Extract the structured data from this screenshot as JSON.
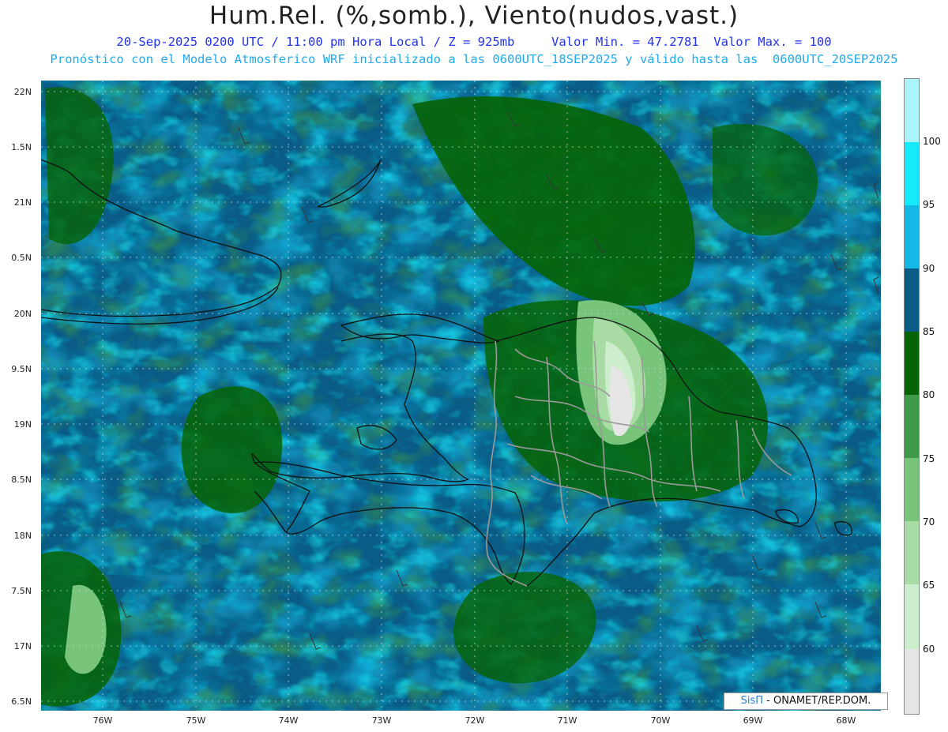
{
  "header": {
    "title": "Hum.Rel. (%,somb.), Viento(nudos,vast.)",
    "line1": "20-Sep-2025 0200 UTC / 11:00 pm Hora Local / Z = 925mb     Valor Min. = 47.2781  Valor Max. = 100",
    "line2": "Pronóstico con el Modelo Atmosferico WRF inicializado a las 0600UTC_18SEP2025 y válido hasta las  0600UTC_20SEP2025"
  },
  "map": {
    "latitude_labels": [
      "22N",
      "1.5N",
      "21N",
      "0.5N",
      "20N",
      "9.5N",
      "19N",
      "8.5N",
      "18N",
      "7.5N",
      "17N",
      "6.5N"
    ],
    "longitude_labels": [
      "76W",
      "75W",
      "74W",
      "73W",
      "72W",
      "71W",
      "70W",
      "69W",
      "68W"
    ],
    "colors": {
      "band_lt60": "#e6e6e6",
      "band_60_65": "#cdeecd",
      "band_65_70": "#a8dca4",
      "band_70_75": "#78c47a",
      "band_75_80": "#3e9a48",
      "band_80_85": "#066405",
      "band_85_90": "#0a5c86",
      "band_90_95": "#14b8e4",
      "band_95_100": "#14eafa",
      "band_gt100": "#aaf4fa",
      "coastline": "#111111",
      "borders": "#9a9a9a"
    }
  },
  "colorbar": {
    "labels": [
      "100",
      "95",
      "90",
      "85",
      "80",
      "75",
      "70",
      "65",
      "60"
    ]
  },
  "credit": {
    "brand": "SisΠ",
    "text": " - ONAMET/REP.DOM."
  }
}
